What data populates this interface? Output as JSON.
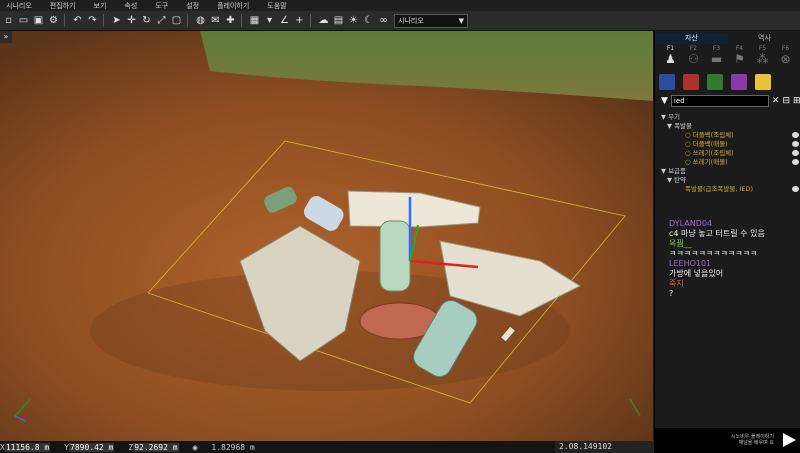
{
  "menu": [
    "시나리오",
    "편집하기",
    "보기",
    "속성",
    "도구",
    "설정",
    "플레이하기",
    "도움말"
  ],
  "toolbar": {
    "icons": [
      "new-file-icon",
      "open-folder-icon",
      "save-icon",
      "settings-icon",
      "undo-icon",
      "redo-icon",
      "select-icon",
      "move-icon",
      "rotate-icon",
      "scale-icon",
      "bounding-box-icon",
      "globe-icon",
      "mail-icon",
      "crosshair-icon",
      "grid-icon",
      "snap-dropdown-icon",
      "angle-icon",
      "plus-icon",
      "weather-icon",
      "terrain-icon",
      "sun-icon",
      "night-icon",
      "binoculars-icon"
    ],
    "scenario_label": "시나리오"
  },
  "statusbar": {
    "x_label": "X",
    "x_value": "11156.8 m",
    "y_label": "Y",
    "y_value": "7890.42 m",
    "z_label": "Z",
    "z_value": "92.2692 m",
    "distance": "1.82968 m",
    "time": "2.08.149102"
  },
  "panel": {
    "tabs": [
      "자산",
      "역사"
    ],
    "fkeys": [
      {
        "label": "F1",
        "icon": "person-icon"
      },
      {
        "label": "F2",
        "icon": "group-icon"
      },
      {
        "label": "F3",
        "icon": "vehicle-icon"
      },
      {
        "label": "F4",
        "icon": "marker-icon"
      },
      {
        "label": "F5",
        "icon": "squad-icon"
      },
      {
        "label": "F6",
        "icon": "cancel-icon"
      }
    ],
    "swatch_colors": [
      "#2b4f9e",
      "#b0302a",
      "#2f7a2f",
      "#8a3aa8",
      "#e8c33a"
    ],
    "search_value": "ied",
    "tree": [
      {
        "indent": 6,
        "text": "▼ 무기",
        "color": "grey",
        "eye": false
      },
      {
        "indent": 12,
        "text": "▼ 폭발물",
        "color": "grey",
        "eye": false
      },
      {
        "indent": 30,
        "text": "○ 더플백(조립체)",
        "color": "gold",
        "eye": true
      },
      {
        "indent": 30,
        "text": "○ 더플백(매몰)",
        "color": "gold",
        "eye": true
      },
      {
        "indent": 30,
        "text": "○ 쓰레기(조립체)",
        "color": "gold",
        "eye": true
      },
      {
        "indent": 30,
        "text": "○ 쓰레기(매몰)",
        "color": "gold",
        "eye": true
      },
      {
        "indent": 6,
        "text": "▼ 보급품",
        "color": "grey",
        "eye": false
      },
      {
        "indent": 12,
        "text": "▼ 탄약",
        "color": "grey",
        "eye": false
      },
      {
        "indent": 30,
        "text": "폭발물(급조폭발물, IED)",
        "color": "gold",
        "eye": true
      }
    ]
  },
  "chat": [
    {
      "name": "DYLAND04",
      "message": "c4 마냥 놓고 터트릴 수 있음",
      "name_color": "purple"
    },
    {
      "name": "옥꿤__",
      "message": "ㅋㅋㅋㅋㅋㅋㅋㅋㅋㅋㅋㅋ",
      "name_color": "green"
    },
    {
      "name": "LEEHO101",
      "message": "가방에 넣을있어",
      "name_color": "purple"
    },
    {
      "name": "죽지",
      "message": "?",
      "name_color": "red"
    }
  ],
  "brand": {
    "line1": "시노비우 플레이하기",
    "line2": "채널을 배우며 요"
  }
}
